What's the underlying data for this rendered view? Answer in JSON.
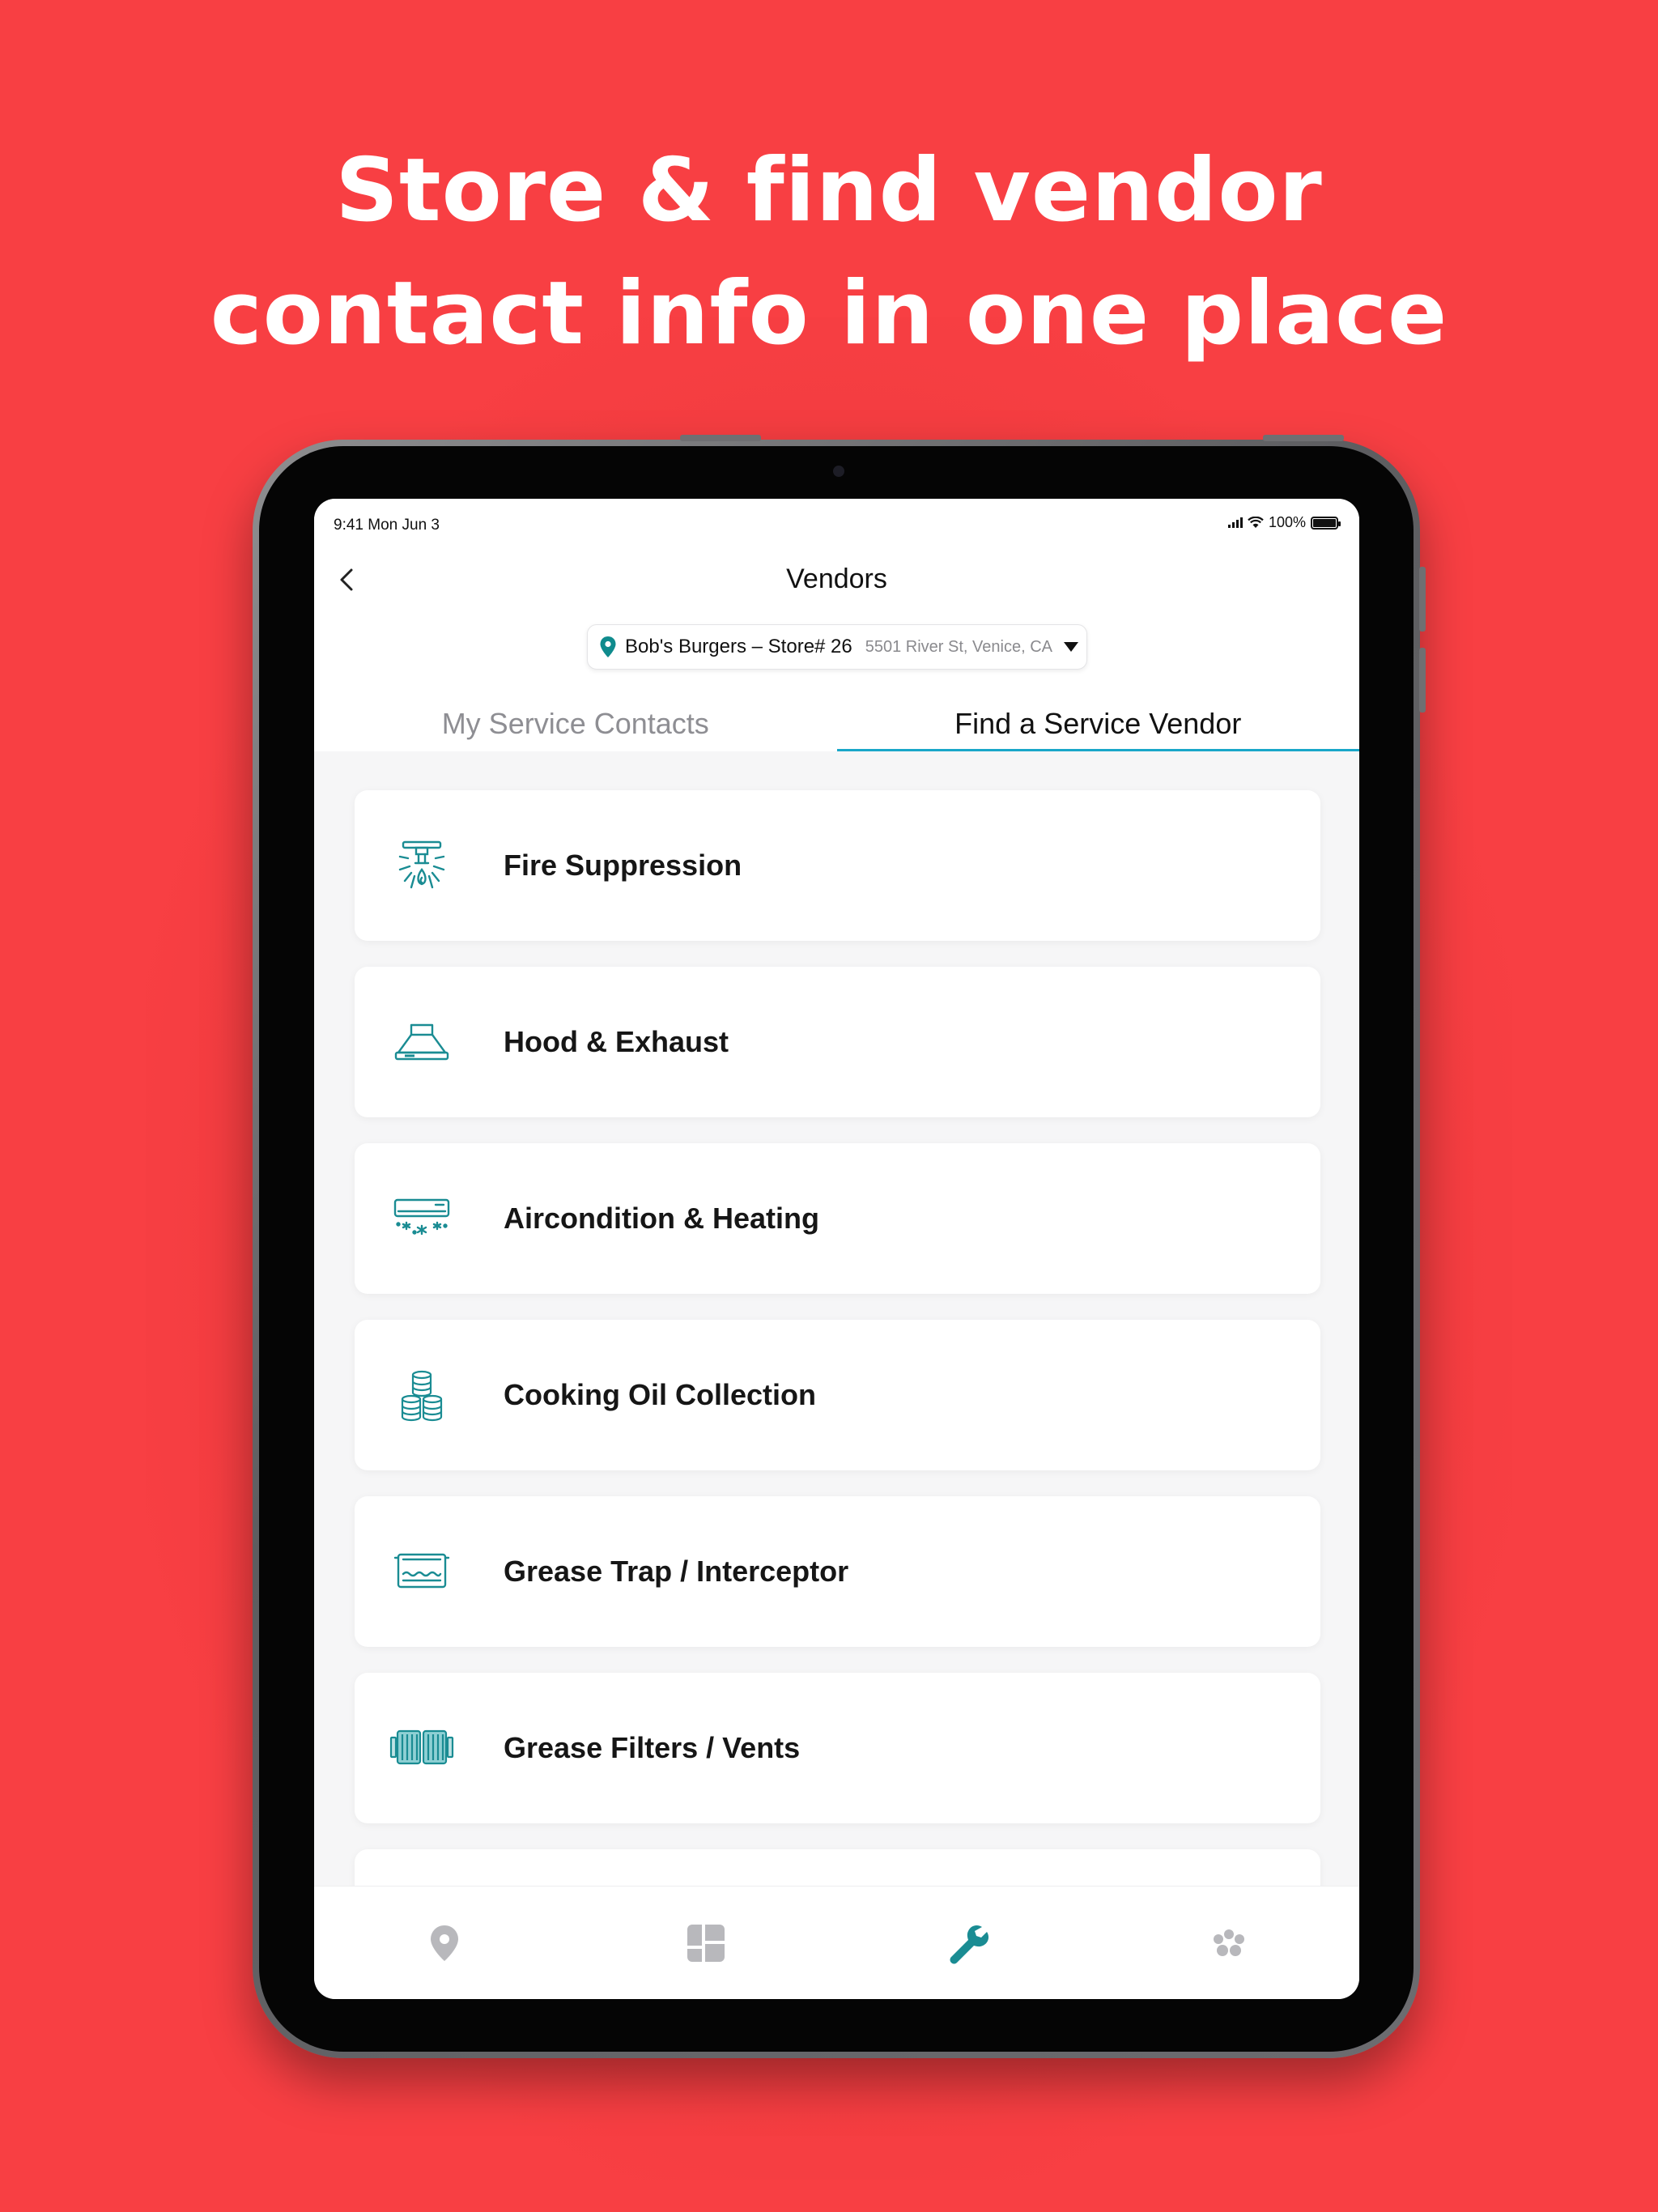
{
  "headline": {
    "line1": "Store & find vendor",
    "line2": "contact info in one place"
  },
  "status_bar": {
    "time": "9:41  Mon Jun 3",
    "battery": "100%"
  },
  "nav": {
    "title": "Vendors",
    "back_icon": "chevron-left-icon"
  },
  "store_picker": {
    "name": "Bob's Burgers – Store# 26",
    "address": "5501 River St, Venice, CA",
    "icon": "location-pin-icon",
    "accent": "#0f8b8d"
  },
  "tabs": [
    {
      "label": "My Service Contacts",
      "active": false
    },
    {
      "label": "Find a Service Vendor",
      "active": true
    }
  ],
  "categories": [
    {
      "label": "Fire Suppression",
      "icon": "sprinkler-icon"
    },
    {
      "label": "Hood & Exhaust",
      "icon": "hood-icon"
    },
    {
      "label": "Aircondition & Heating",
      "icon": "air-conditioner-icon"
    },
    {
      "label": "Cooking Oil Collection",
      "icon": "oil-barrels-icon"
    },
    {
      "label": "Grease Trap / Interceptor",
      "icon": "grease-trap-icon"
    },
    {
      "label": "Grease Filters / Vents",
      "icon": "filter-vents-icon"
    }
  ],
  "tabbar": [
    {
      "icon": "location-icon",
      "active": false
    },
    {
      "icon": "dashboard-icon",
      "active": false
    },
    {
      "icon": "wrench-icon",
      "active": true
    },
    {
      "icon": "paw-icon",
      "active": false
    }
  ],
  "colors": {
    "background": "#f83f43",
    "accent": "#19a7c9",
    "icon_teal": "#1a8c93",
    "inactive_icon": "#b8b8bc"
  }
}
